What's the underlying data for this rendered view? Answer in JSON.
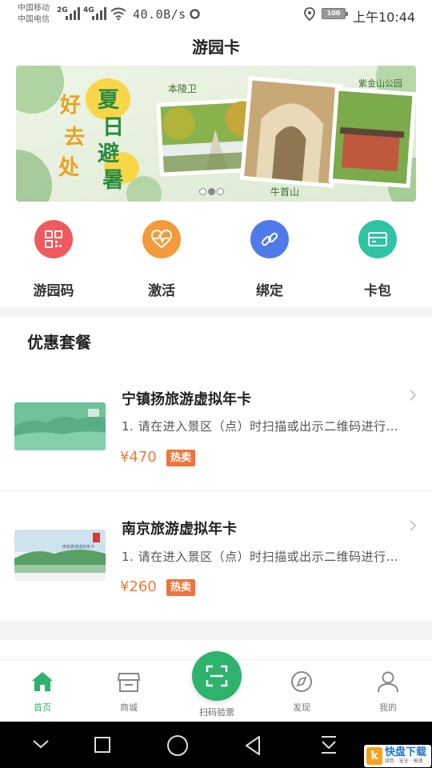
{
  "status_bar": {
    "carrier_1": "中国移动",
    "carrier_2": "中国电信",
    "net_1": "2G",
    "net_2": "4G",
    "speed": "40.0B/s",
    "battery": "100",
    "time": "上午10:44"
  },
  "header": {
    "title": "游园卡"
  },
  "banner": {
    "slogan_chars": [
      "好",
      "去",
      "处",
      "夏",
      "日",
      "避",
      "暑"
    ],
    "tags": [
      "本陵卫",
      "紫金山公园",
      "牛首山"
    ],
    "slide_count": 3,
    "active_slide": 1
  },
  "quick_actions": [
    {
      "label": "游园码",
      "icon": "qr-code-icon",
      "color": "#ef5a5e"
    },
    {
      "label": "激活",
      "icon": "heart-pulse-icon",
      "color": "#f59a3a"
    },
    {
      "label": "绑定",
      "icon": "link-icon",
      "color": "#4f7bea"
    },
    {
      "label": "卡包",
      "icon": "card-wallet-icon",
      "color": "#2fc3a3"
    }
  ],
  "offers": {
    "title": "优惠套餐",
    "products": [
      {
        "name": "宁镇扬旅游虚拟年卡",
        "desc": "1. 请在进入景区（点）时扫描或出示二维码进行…",
        "price": "¥470",
        "badge": "热卖"
      },
      {
        "name": "南京旅游虚拟年卡",
        "desc": "1. 请在进入景区（点）时扫描或出示二维码进行…",
        "price": "¥260",
        "badge": "热卖",
        "card_print": "南京旅游虚拟年卡"
      }
    ]
  },
  "tabs": {
    "home": "首页",
    "mall": "商城",
    "scan": "扫码验票",
    "discover": "发现",
    "mine": "我的"
  },
  "watermark": {
    "logo": "k",
    "main": "快盘下载",
    "sub": "绿色 · 安全 · 高速"
  },
  "colors": {
    "accent": "#2db36c",
    "price": "#f07a36",
    "badge": "#f0743a"
  }
}
